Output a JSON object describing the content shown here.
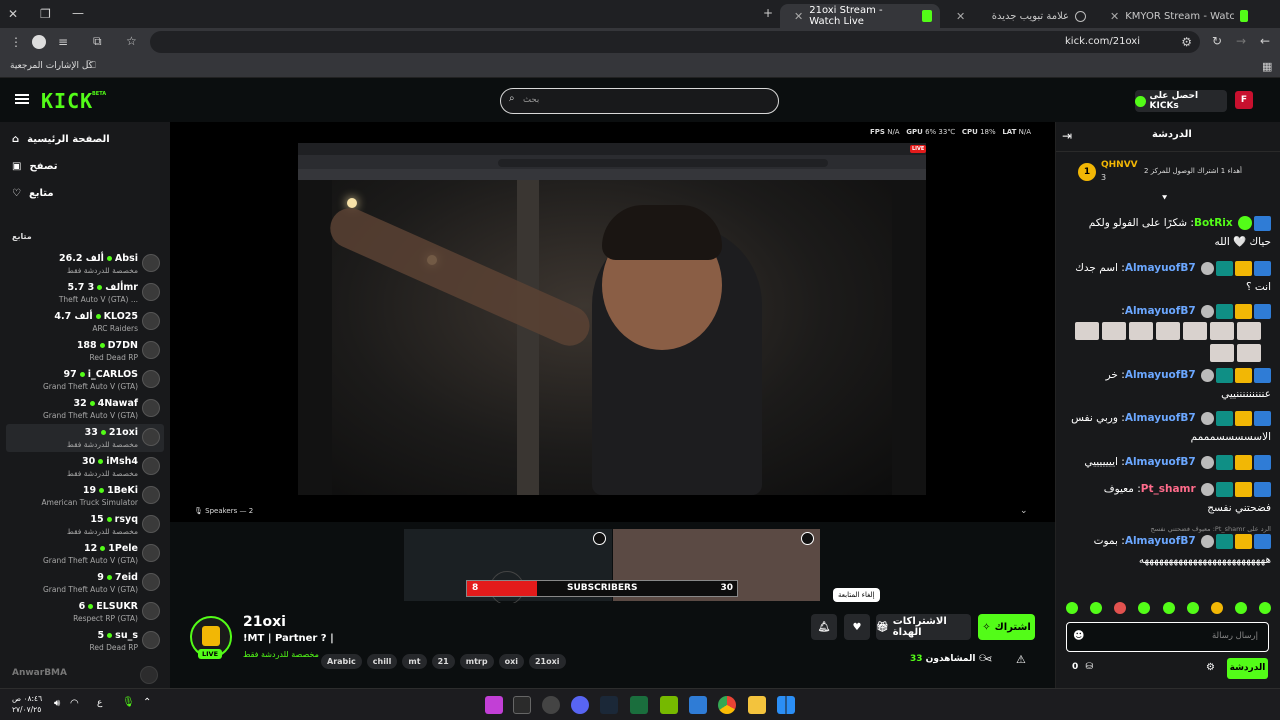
{
  "browser": {
    "tabs": [
      {
        "title": "KMYOR Stream - Watch Live on",
        "active": false
      },
      {
        "title": "علامة تبويب جديدة",
        "active": false
      },
      {
        "title": "21oxi Stream - Watch Live",
        "active": true
      }
    ],
    "url": "kick.com/21oxi",
    "bookmarks_label": "كل الإشارات المرجعية"
  },
  "header": {
    "logo": "KICK",
    "logo_beta": "BETA",
    "search_placeholder": "بحث",
    "get_kicks_label": "احصل على KICKs"
  },
  "sidebar": {
    "nav": [
      {
        "label": "الصفحة الرئيسية",
        "icon": "home-icon"
      },
      {
        "label": "تصفح",
        "icon": "browse-icon"
      },
      {
        "label": "متابع",
        "icon": "heart-icon"
      }
    ],
    "section_title": "متابع",
    "channels": [
      {
        "name": "Absi",
        "viewers": "26.2 ألف",
        "sub": "مخصصة للدردشة فقط"
      },
      {
        "name": "3mr",
        "viewers": "5.7 ألف",
        "sub": "Theft Auto V (GTA) ..."
      },
      {
        "name": "KLO25",
        "viewers": "4.7 ألف",
        "sub": "ARC Raiders"
      },
      {
        "name": "D7DN",
        "viewers": "188",
        "sub": "Red Dead RP"
      },
      {
        "name": "i_CARLOS",
        "viewers": "97",
        "sub": "Grand Theft Auto V (GTA)"
      },
      {
        "name": "4Nawaf",
        "viewers": "32",
        "sub": "Grand Theft Auto V (GTA)"
      },
      {
        "name": "21oxi",
        "viewers": "33",
        "sub": "مخصصة للدردشة فقط"
      },
      {
        "name": "iMsh4",
        "viewers": "30",
        "sub": "مخصصة للدردشة فقط"
      },
      {
        "name": "1BeKi",
        "viewers": "19",
        "sub": "American Truck Simulator"
      },
      {
        "name": "rsyq",
        "viewers": "15",
        "sub": "مخصصة للدردشة فقط"
      },
      {
        "name": "1Pele",
        "viewers": "12",
        "sub": "Grand Theft Auto V (GTA)"
      },
      {
        "name": "7eid",
        "viewers": "9",
        "sub": "Grand Theft Auto V (GTA)"
      },
      {
        "name": "ELSUKR",
        "viewers": "6",
        "sub": "Respect RP (GTA)"
      },
      {
        "name": "su_s",
        "viewers": "5",
        "sub": "Red Dead RP"
      }
    ],
    "offline_channel": "AnwarBMA"
  },
  "player": {
    "stats": {
      "fps_label": "FPS",
      "fps": "N/A",
      "gpu_label": "GPU",
      "gpu": "6%",
      "gpu_temp": "33℃",
      "cpu_label": "CPU",
      "cpu": "18%",
      "lat_label": "LAT",
      "lat": "N/A"
    },
    "speakers": "Speakers — 2",
    "live_badge": "LIVE",
    "subscribers_left": "8",
    "subscribers_label": "SUBSCRIBERS",
    "subscribers_right": "30"
  },
  "stream": {
    "channel": "21oxi",
    "title": "!MT | Partner ? |",
    "category": "مخصصة للدردشة فقط",
    "live": "LIVE",
    "tags": [
      "Arabic",
      "chill",
      "mt",
      "21",
      "mtrp",
      "oxi",
      "21oxi"
    ],
    "subscribe_label": "اشتراك",
    "gift_label": "الاشتراكات الهداة",
    "unfollow_tooltip": "إلغاء المتابعة",
    "viewers_label": "المشاهدون",
    "viewers": "33"
  },
  "chat": {
    "title": "الدردشة",
    "pinned_user": "QHNVV",
    "pinned_rank": "1",
    "pinned_count": "3",
    "pinned_text": "أهداء 1 اشتراك الوصول للمركز 2",
    "messages": [
      {
        "user": "BotRix",
        "text": "شكرًا على الفولو ولكم حياك 🤍 الله",
        "color": "#53fc18"
      },
      {
        "user": "AlmayuofB7",
        "text": "اسم جدك انت ؟",
        "color": "#6ba7ff"
      },
      {
        "user": "AlmayuofB7",
        "text": "",
        "color": "#6ba7ff"
      },
      {
        "user": "AlmayuofB7",
        "text": "خر عنننننننننييي",
        "color": "#6ba7ff"
      },
      {
        "user": "AlmayuofB7",
        "text": "وربي نفس الاسسسسسمممم",
        "color": "#6ba7ff"
      },
      {
        "user": "AlmayuofB7",
        "text": "ايييييييي",
        "color": "#6ba7ff"
      },
      {
        "user": "Pt_shamr",
        "text": "معيوف فضحتني نفسج",
        "color": "#ff6b8b"
      },
      {
        "user": "AlmayuofB7",
        "text": "بموت ههههههههههههههههههههههههههه",
        "color": "#6ba7ff"
      }
    ],
    "reply_to": "الرد على Pt_shamr: معيوف فضحتني نفسج",
    "input_placeholder": "إرسال رسالة",
    "send_label": "الدردشة",
    "points": "0"
  },
  "taskbar": {
    "time": "٠٨:٤٦ ص",
    "date": "٢٧/٠٧/٢٥",
    "lang": "ع"
  }
}
